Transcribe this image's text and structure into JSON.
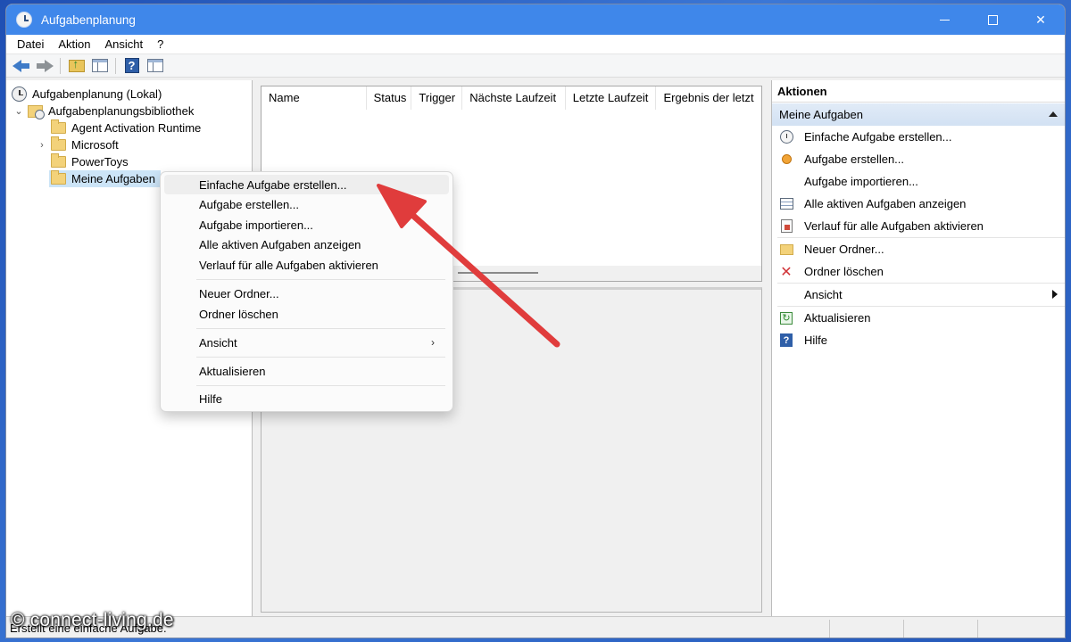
{
  "window": {
    "title": "Aufgabenplanung"
  },
  "menubar": {
    "items": [
      "Datei",
      "Aktion",
      "Ansicht",
      "?"
    ]
  },
  "tree": {
    "root": "Aufgabenplanung (Lokal)",
    "library": "Aufgabenplanungsbibliothek",
    "children": [
      "Agent Activation Runtime",
      "Microsoft",
      "PowerToys",
      "Meine Aufgaben"
    ]
  },
  "list": {
    "columns": [
      "Name",
      "Status",
      "Trigger",
      "Nächste Laufzeit",
      "Letzte Laufzeit",
      "Ergebnis der letzt"
    ]
  },
  "context_menu": {
    "items": [
      "Einfache Aufgabe erstellen...",
      "Aufgabe erstellen...",
      "Aufgabe importieren...",
      "Alle aktiven Aufgaben anzeigen",
      "Verlauf für alle Aufgaben aktivieren",
      "Neuer Ordner...",
      "Ordner löschen",
      "Ansicht",
      "Aktualisieren",
      "Hilfe"
    ]
  },
  "actions": {
    "title": "Aktionen",
    "section": "Meine Aufgaben",
    "items": [
      "Einfache Aufgabe erstellen...",
      "Aufgabe erstellen...",
      "Aufgabe importieren...",
      "Alle aktiven Aufgaben anzeigen",
      "Verlauf für alle Aufgaben aktivieren",
      "Neuer Ordner...",
      "Ordner löschen",
      "Ansicht",
      "Aktualisieren",
      "Hilfe"
    ]
  },
  "statusbar": {
    "text": "Erstellt eine einfache Aufgabe."
  },
  "watermark": "© connect-living.de",
  "colors": {
    "titlebar": "#3f87ea",
    "selection": "#cce4f7",
    "annotation_arrow": "#e03c3c",
    "delete_icon": "#d13438"
  },
  "icons": [
    "clock-icon",
    "back-arrow-icon",
    "forward-arrow-icon",
    "folder-up-icon",
    "console-tree-icon",
    "help-icon",
    "action-pane-icon",
    "folder-icon",
    "chevron-right-icon",
    "delete-icon",
    "refresh-icon"
  ]
}
